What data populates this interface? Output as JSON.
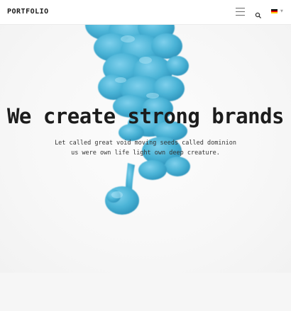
{
  "header": {
    "logo": "PORTFOLIO",
    "menu_icon": "hamburger-menu-icon",
    "search_icon": "search-icon",
    "language_flag": "german-flag-icon"
  },
  "hero": {
    "headline": "We create strong brands",
    "subtext": "Let called great void moving seeds called dominion us were own life light own deep creature.",
    "ink_color": "#4ab3d6"
  },
  "colors": {
    "background": "#f5f5f5",
    "header_bg": "#ffffff",
    "text": "#1c1c1c",
    "ink": "#4ab3d6",
    "ink_dark": "#2e98bf"
  }
}
